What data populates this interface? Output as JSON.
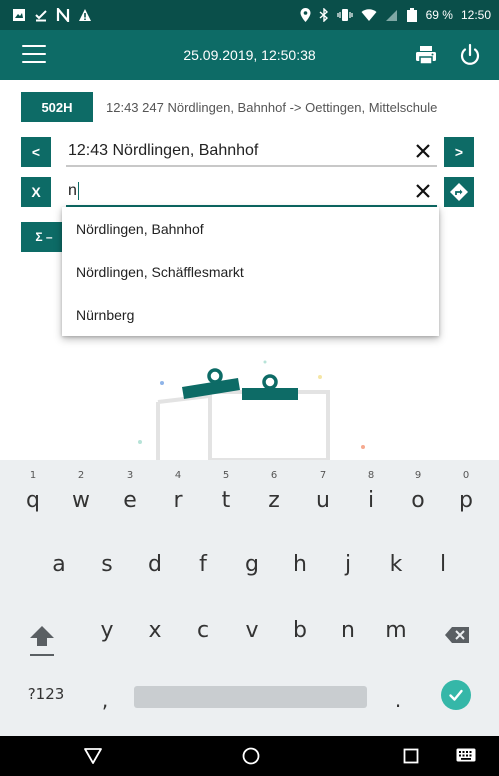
{
  "status_bar": {
    "battery_pct": "69 %",
    "time": "12:50"
  },
  "app_bar": {
    "datetime": "25.09.2019, 12:50:38"
  },
  "route": {
    "button_label": "502H",
    "description": "12:43 247 Nördlingen, Bahnhof -> Oettingen, Mittelschule"
  },
  "from_row": {
    "prev_label": "<",
    "value": "12:43 Nördlingen, Bahnhof",
    "next_label": ">"
  },
  "to_row": {
    "clear_label": "X",
    "value": "n"
  },
  "sum_button": {
    "label": "Σ –"
  },
  "suggestions": [
    "Nördlingen, Bahnhof",
    "Nördlingen, Schäfflesmarkt",
    "Nürnberg"
  ],
  "keyboard": {
    "row1": [
      {
        "key": "q",
        "hint": "1"
      },
      {
        "key": "w",
        "hint": "2"
      },
      {
        "key": "e",
        "hint": "3"
      },
      {
        "key": "r",
        "hint": "4"
      },
      {
        "key": "t",
        "hint": "5"
      },
      {
        "key": "z",
        "hint": "6"
      },
      {
        "key": "u",
        "hint": "7"
      },
      {
        "key": "i",
        "hint": "8"
      },
      {
        "key": "o",
        "hint": "9"
      },
      {
        "key": "p",
        "hint": "0"
      }
    ],
    "row2": [
      "a",
      "s",
      "d",
      "f",
      "g",
      "h",
      "j",
      "k",
      "l"
    ],
    "row3": [
      "y",
      "x",
      "c",
      "v",
      "b",
      "n",
      "m"
    ],
    "symbols_label": "?123",
    "comma_label": ",",
    "period_label": "."
  },
  "colors": {
    "primary": "#0d6b66",
    "status_bar": "#0a4f4a",
    "accent": "#35b7a8"
  }
}
